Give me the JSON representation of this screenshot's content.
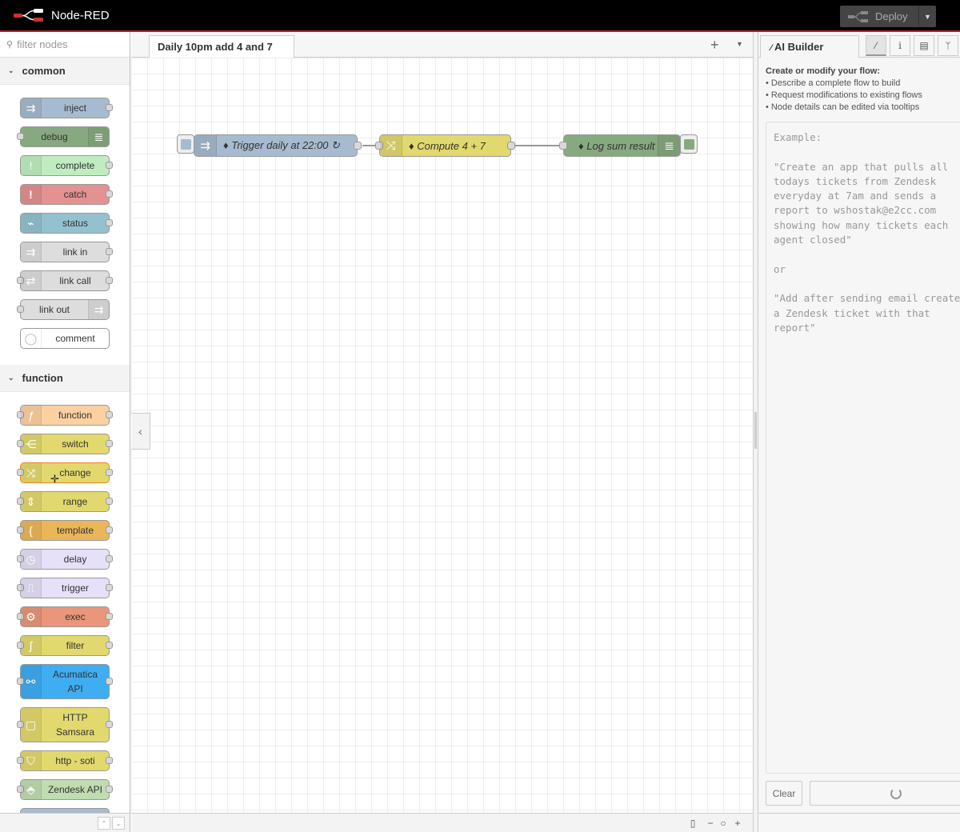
{
  "header": {
    "app_name": "Node-RED",
    "deploy_label": "Deploy"
  },
  "palette": {
    "filter_placeholder": "filter nodes",
    "categories": [
      {
        "name": "common",
        "nodes": [
          "inject",
          "debug",
          "complete",
          "catch",
          "status",
          "link in",
          "link call",
          "link out",
          "comment"
        ]
      },
      {
        "name": "function",
        "nodes": [
          "function",
          "switch",
          "change",
          "range",
          "template",
          "delay",
          "trigger",
          "exec",
          "filter",
          "Acumatica API",
          "HTTP Samsara",
          "http - soti",
          "Zendesk API"
        ]
      }
    ]
  },
  "workspace": {
    "tab_label": "Daily 10pm add 4 and 7",
    "flow_nodes": {
      "inject": "Trigger daily at 22:00 ↻",
      "change": "Compute 4 + 7",
      "debug": "Log sum result"
    }
  },
  "sidebar": {
    "tab_label": "AI Builder",
    "help_title": "Create or modify your flow:",
    "help_items": [
      "• Describe a complete flow to build",
      "• Request modifications to existing flows",
      "• Node details can be edited via tooltips"
    ],
    "example_text": "Example:\n\n\"Create an app that pulls all\ntodays tickets from Zendesk\neveryday at 7am and sends a\nreport to wshostak@e2cc.com\nshowing how many tickets each\nagent closed\"\n\nor\n\n\"Add after sending email create\na Zendesk ticket with that\nreport\"",
    "clear_label": "Clear"
  },
  "colors": {
    "inject": "#a6bbcf",
    "debug": "#87a980",
    "complete": "#c0edc0",
    "catch": "#e49191",
    "status": "#94c1d0",
    "link": "#dddddd",
    "comment": "#ffffff",
    "function": "#fdd0a2",
    "change": "#e2d96e",
    "template": "#ebb659",
    "delay": "#e6e0f8",
    "exec": "#e9967a",
    "acumatica": "#3fadf1"
  }
}
